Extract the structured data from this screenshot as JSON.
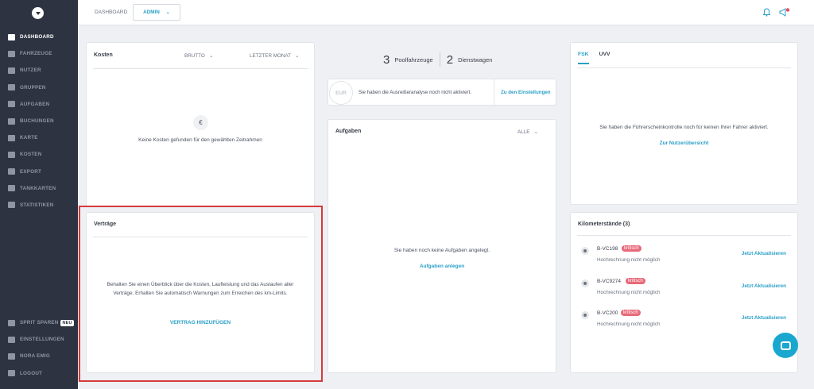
{
  "sidebar": {
    "nav": [
      {
        "label": "DASHBOARD",
        "icon": "dashboard-icon",
        "active": true
      },
      {
        "label": "FAHRZEUGE",
        "icon": "car-icon"
      },
      {
        "label": "NUTZER",
        "icon": "user-icon"
      },
      {
        "label": "GRUPPEN",
        "icon": "group-icon"
      },
      {
        "label": "AUFGABEN",
        "icon": "clipboard-icon"
      },
      {
        "label": "BUCHUNGEN",
        "icon": "calendar-icon"
      },
      {
        "label": "KARTE",
        "icon": "map-icon"
      },
      {
        "label": "KOSTEN",
        "icon": "credit-card-icon"
      },
      {
        "label": "EXPORT",
        "icon": "download-icon"
      },
      {
        "label": "TANKKARTEN",
        "icon": "fuel-icon"
      },
      {
        "label": "STATISTIKEN",
        "icon": "chart-icon"
      }
    ],
    "bottom": [
      {
        "label": "SPRIT SPAREN",
        "icon": "person-icon",
        "badge": "NEU"
      },
      {
        "label": "EINSTELLUNGEN",
        "icon": "sliders-icon"
      },
      {
        "label": "NORA EMIG",
        "icon": "user-icon"
      },
      {
        "label": "LOGOUT",
        "icon": "power-icon"
      }
    ]
  },
  "header": {
    "breadcrumb": "DASHBOARD",
    "role": "ADMIN"
  },
  "kosten": {
    "title": "Kosten",
    "filter1": "BRUTTO",
    "filter2": "LETZTER MONAT",
    "icon": "€",
    "empty": "Keine Kosten gefunden für den gewählten Zeitrahmen"
  },
  "vertraege": {
    "title": "Verträge",
    "text": "Behalten Sie einen Überblick über die Kosten, Laufleistung und das Auslaufen aller Verträge. Erhalten Sie automatisch Warnungen zum Erreichen des km-Limits.",
    "action": "VERTRAG HINZUFÜGEN"
  },
  "counts": {
    "pool_num": "3",
    "pool_label": "Poolfahrzeuge",
    "dienst_num": "2",
    "dienst_label": "Dienstwagen"
  },
  "ausreisser": {
    "badge": "EUR",
    "message": "Sie haben die Ausreißeranalyse noch nicht aktiviert.",
    "link": "Zu den Einstellungen"
  },
  "aufgaben": {
    "title": "Aufgaben",
    "filter": "ALLE",
    "empty": "Sie haben noch keine Aufgaben angelegt.",
    "action": "Aufgaben anlegen"
  },
  "fsk": {
    "tabs": [
      "FSK",
      "UVV"
    ],
    "empty": "Sie haben die Führerscheinkontrolle noch für keinen Ihrer Fahrer aktiviert.",
    "link": "Zur Nutzerübersicht"
  },
  "km": {
    "title": "Kilometerstände (3)",
    "rows": [
      {
        "plate": "B-VC198",
        "status": "kritisch",
        "sub": "Hochrechnung nicht möglich",
        "action": "Jetzt Aktualisieren"
      },
      {
        "plate": "B-VC9274",
        "status": "kritisch",
        "sub": "Hochrechnung nicht möglich",
        "action": "Jetzt Aktualisieren"
      },
      {
        "plate": "B-VC200",
        "status": "kritisch",
        "sub": "Hochrechnung nicht möglich",
        "action": "Jetzt Aktualisieren"
      }
    ]
  },
  "colors": {
    "sidebar": "#2d3340",
    "accent": "#2aa0c8",
    "critical": "#e86a7a",
    "highlight": "#d63a3a"
  }
}
